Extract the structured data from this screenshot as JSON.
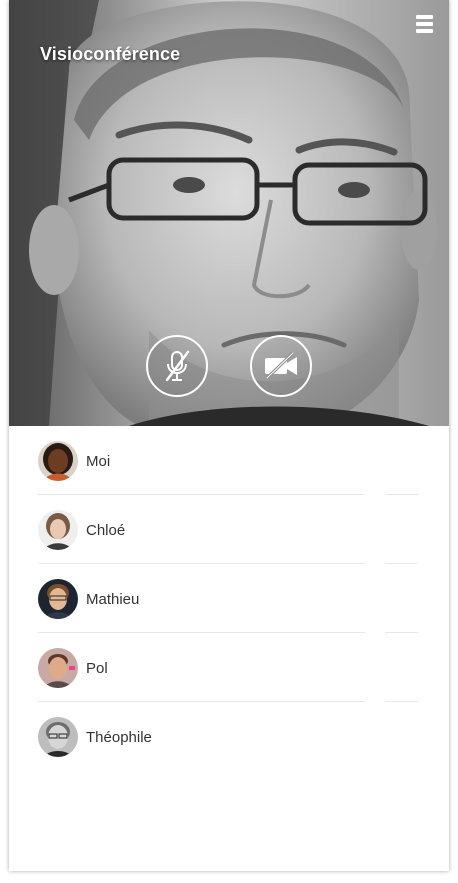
{
  "header": {
    "title": "Visioconférence"
  },
  "controls": {
    "mic_state": "muted",
    "camera_state": "muted"
  },
  "participants": [
    {
      "name": "Moi"
    },
    {
      "name": "Chloé"
    },
    {
      "name": "Mathieu"
    },
    {
      "name": "Pol"
    },
    {
      "name": "Théophile"
    }
  ],
  "colors": {
    "text": "#333333",
    "divider": "#e8e8e8",
    "overlay_text": "#ffffff"
  }
}
